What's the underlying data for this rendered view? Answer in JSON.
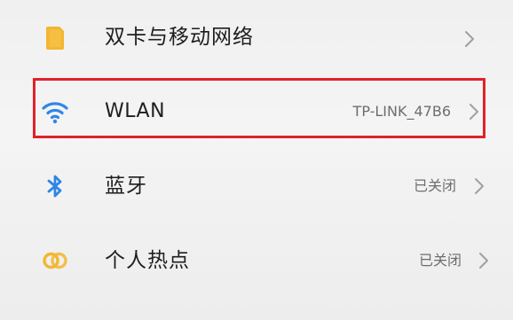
{
  "settings": {
    "items": [
      {
        "id": "sim",
        "label": "双卡与移动网络",
        "value": "",
        "icon": "sim-card-icon"
      },
      {
        "id": "wlan",
        "label": "WLAN",
        "value": "TP-LINK_47B6",
        "icon": "wifi-icon"
      },
      {
        "id": "bluetooth",
        "label": "蓝牙",
        "value": "已关闭",
        "icon": "bluetooth-icon"
      },
      {
        "id": "hotspot",
        "label": "个人热点",
        "value": "已关闭",
        "icon": "hotspot-icon"
      }
    ]
  },
  "colors": {
    "sim_icon": "#f2b630",
    "wifi_icon": "#2f86e6",
    "bluetooth_icon": "#2f86e6",
    "hotspot_icon": "#f2b630",
    "highlight": "#e0222a",
    "chevron": "#9a9a9a"
  }
}
